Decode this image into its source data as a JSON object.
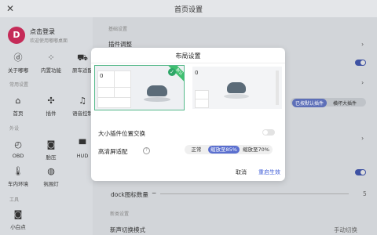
{
  "header": {
    "title": "首页设置"
  },
  "sidebar": {
    "login_title": "点击登录",
    "login_subtitle": "欢迎使用嘟嘟桌面",
    "top_items": [
      "关于嘟嘟",
      "内置功能",
      "原车适配"
    ],
    "common_label": "常用设置",
    "common_items": [
      "首页",
      "插件",
      "语音控制"
    ],
    "plugins_label": "外设",
    "plugin_items": [
      "OBD",
      "胎压",
      "HUD",
      "车内环境",
      "氛围灯"
    ],
    "tools_label": "工具",
    "tool_items": [
      "小白点"
    ]
  },
  "content": {
    "section_basic": "基础设置",
    "plugin_adjust": "插件调整",
    "layout_label": "布局设置",
    "pills": [
      "已按默认插件",
      "横坏大插件"
    ],
    "dock_label": "dock图标数量",
    "dock_value": "5",
    "section_advanced": "新类设置",
    "bottom_label": "新声切换模式",
    "bottom_value": "手动切换"
  },
  "modal": {
    "title": "布局设置",
    "preview_ribbon": "默认",
    "preview_left_value": "0",
    "preview_right_value": "0",
    "swap_label": "大小插件位置交换",
    "adapt_label": "高清屏适配",
    "segments": [
      "正常",
      "缩放至85%",
      "缩放至70%"
    ],
    "selected_segment": 1,
    "cancel_label": "取消",
    "restart_label": "重启生效",
    "accent_color": "#5a6fcf"
  }
}
